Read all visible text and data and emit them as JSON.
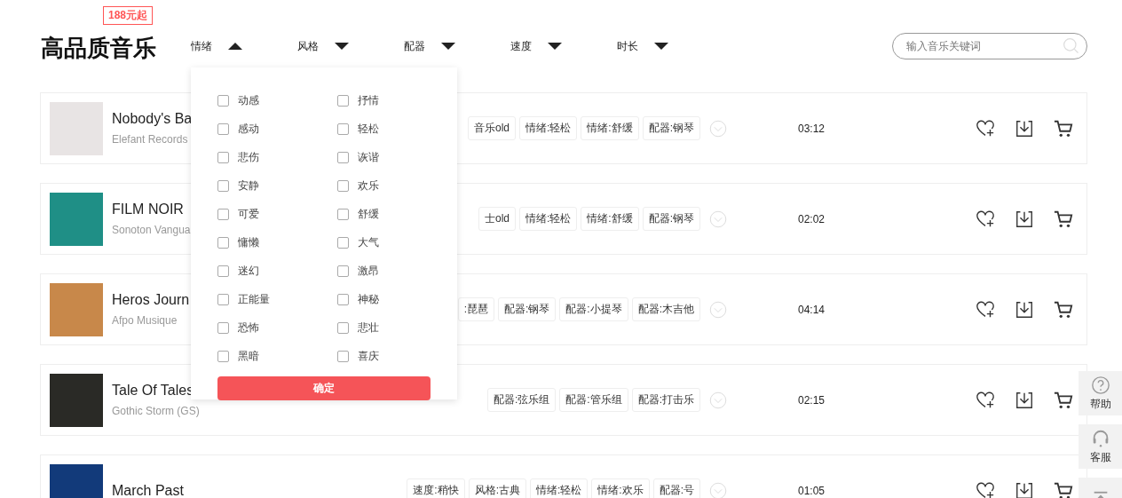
{
  "header": {
    "title": "高品质音乐",
    "badge": "188元起"
  },
  "filters": [
    {
      "label": "情绪",
      "expanded": true
    },
    {
      "label": "风格",
      "expanded": false
    },
    {
      "label": "配器",
      "expanded": false
    },
    {
      "label": "速度",
      "expanded": false
    },
    {
      "label": "时长",
      "expanded": false
    }
  ],
  "search": {
    "placeholder": "输入音乐关键词"
  },
  "dropdown": {
    "options": [
      {
        "label": "动感",
        "checked": false
      },
      {
        "label": "抒情",
        "checked": false
      },
      {
        "label": "感动",
        "checked": false
      },
      {
        "label": "轻松",
        "checked": false
      },
      {
        "label": "悲伤",
        "checked": false
      },
      {
        "label": "诙谐",
        "checked": false
      },
      {
        "label": "安静",
        "checked": false
      },
      {
        "label": "欢乐",
        "checked": false
      },
      {
        "label": "可爱",
        "checked": false
      },
      {
        "label": "舒缓",
        "checked": false
      },
      {
        "label": "慵懒",
        "checked": false
      },
      {
        "label": "大气",
        "checked": false
      },
      {
        "label": "迷幻",
        "checked": false
      },
      {
        "label": "激昂",
        "checked": false
      },
      {
        "label": "正能量",
        "checked": false
      },
      {
        "label": "神秘",
        "checked": false
      },
      {
        "label": "恐怖",
        "checked": false
      },
      {
        "label": "悲壮",
        "checked": false
      },
      {
        "label": "黑暗",
        "checked": false
      },
      {
        "label": "喜庆",
        "checked": false
      }
    ],
    "confirm": "确定"
  },
  "tracks": [
    {
      "title": "Nobody's Ba",
      "artist": "Elefant Records",
      "color": "#e8e4e4",
      "tags": [
        "音乐old",
        "情绪:轻松",
        "情绪:舒缓",
        "配器:钢琴"
      ],
      "duration": "03:12"
    },
    {
      "title": "FILM NOIR",
      "artist": "Sonoton Vangua",
      "color": "#1f8f86",
      "tags": [
        "士old",
        "情绪:轻松",
        "情绪:舒缓",
        "配器:钢琴"
      ],
      "duration": "02:02"
    },
    {
      "title": "Heros Journ",
      "artist": "Afpo Musique",
      "color": "#c8884a",
      "tags": [
        ":琵琶",
        "配器:钢琴",
        "配器:小提琴",
        "配器:木吉他"
      ],
      "duration": "04:14"
    },
    {
      "title": "Tale Of Tales",
      "artist": "Gothic Storm (GS)",
      "color": "#2a2a26",
      "tags": [
        "配器:弦乐组",
        "配器:管乐组",
        "配器:打击乐"
      ],
      "duration": "02:15"
    },
    {
      "title": "March Past",
      "color": "#123a7a",
      "tags": [
        "速度:稍快",
        "风格:古典",
        "情绪:轻松",
        "情绪:欢乐",
        "配器:号"
      ],
      "duration": "01:05"
    }
  ],
  "side": [
    {
      "kind": "help",
      "label": "帮助"
    },
    {
      "kind": "service",
      "label": "客服"
    },
    {
      "kind": "top"
    }
  ]
}
